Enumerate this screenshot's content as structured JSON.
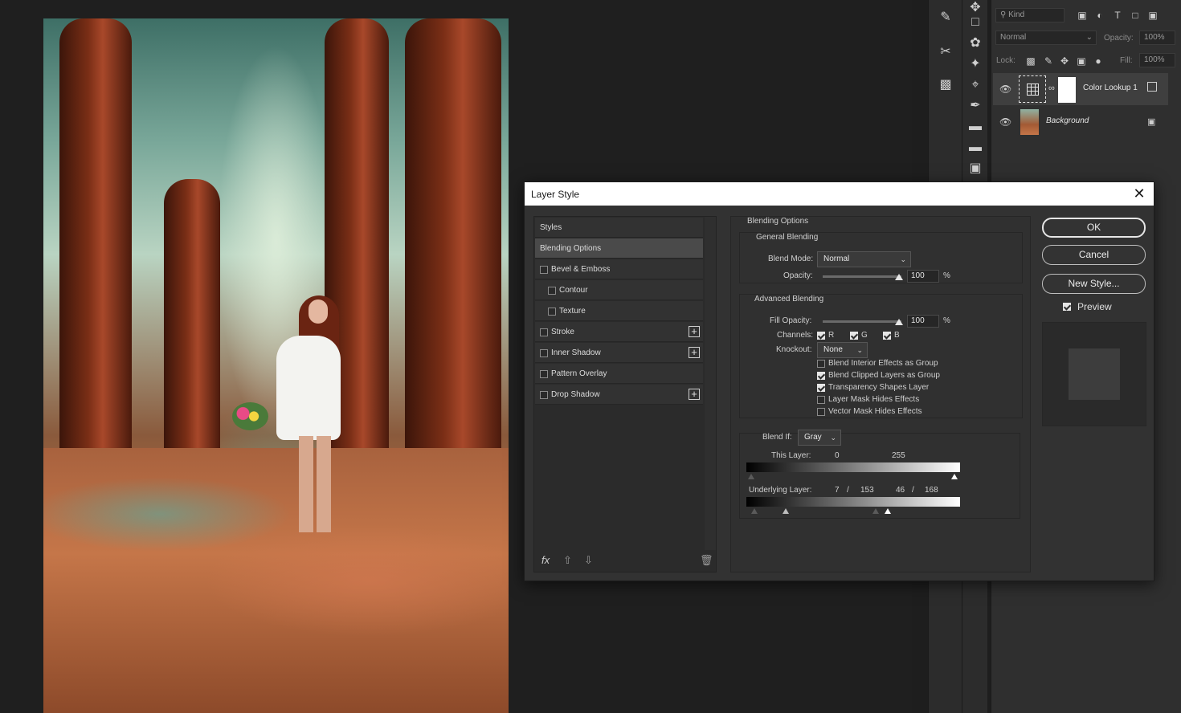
{
  "layers_panel": {
    "filter_kind": "Kind",
    "blend_mode": "Normal",
    "opacity_label": "Opacity:",
    "opacity_value": "100%",
    "lock_label": "Lock:",
    "fill_label": "Fill:",
    "fill_value": "100%",
    "layers": [
      {
        "name": "Color Lookup 1",
        "selected": true
      },
      {
        "name": "Background",
        "selected": false,
        "locked": true
      }
    ]
  },
  "dialog": {
    "title": "Layer Style",
    "styles_list": {
      "items": [
        {
          "label": "Styles",
          "header": true
        },
        {
          "label": "Blending Options",
          "selected": true
        },
        {
          "label": "Bevel & Emboss",
          "checked": false
        },
        {
          "label": "Contour",
          "checked": false,
          "indent": true
        },
        {
          "label": "Texture",
          "checked": false,
          "indent": true
        },
        {
          "label": "Stroke",
          "checked": false,
          "add": true
        },
        {
          "label": "Inner Shadow",
          "checked": false,
          "add": true
        },
        {
          "label": "Pattern Overlay",
          "checked": false
        },
        {
          "label": "Drop Shadow",
          "checked": false,
          "add": true
        }
      ],
      "fx_label": "fx"
    },
    "blending": {
      "section_title": "Blending Options",
      "general_title": "General Blending",
      "blend_mode_label": "Blend Mode:",
      "blend_mode_value": "Normal",
      "opacity_label": "Opacity:",
      "opacity_value": "100",
      "percent": "%",
      "advanced_title": "Advanced Blending",
      "fill_opacity_label": "Fill Opacity:",
      "fill_opacity_value": "100",
      "channels_label": "Channels:",
      "channels": [
        {
          "label": "R",
          "checked": true
        },
        {
          "label": "G",
          "checked": true
        },
        {
          "label": "B",
          "checked": true
        }
      ],
      "knockout_label": "Knockout:",
      "knockout_value": "None",
      "options": [
        {
          "label": "Blend Interior Effects as Group",
          "checked": false
        },
        {
          "label": "Blend Clipped Layers as Group",
          "checked": true
        },
        {
          "label": "Transparency Shapes Layer",
          "checked": true
        },
        {
          "label": "Layer Mask Hides Effects",
          "checked": false
        },
        {
          "label": "Vector Mask Hides Effects",
          "checked": false
        }
      ],
      "blend_if_label": "Blend If:",
      "blend_if_value": "Gray",
      "this_layer_label": "This Layer:",
      "this_layer_low": "0",
      "this_layer_high": "255",
      "underlying_label": "Underlying Layer:",
      "underlying_v1": "7",
      "underlying_sep1": "/",
      "underlying_v2": "153",
      "underlying_v3": "46",
      "underlying_sep2": "/",
      "underlying_v4": "168"
    },
    "buttons": {
      "ok": "OK",
      "cancel": "Cancel",
      "new_style": "New Style...",
      "preview_label": "Preview",
      "preview_checked": true
    }
  }
}
